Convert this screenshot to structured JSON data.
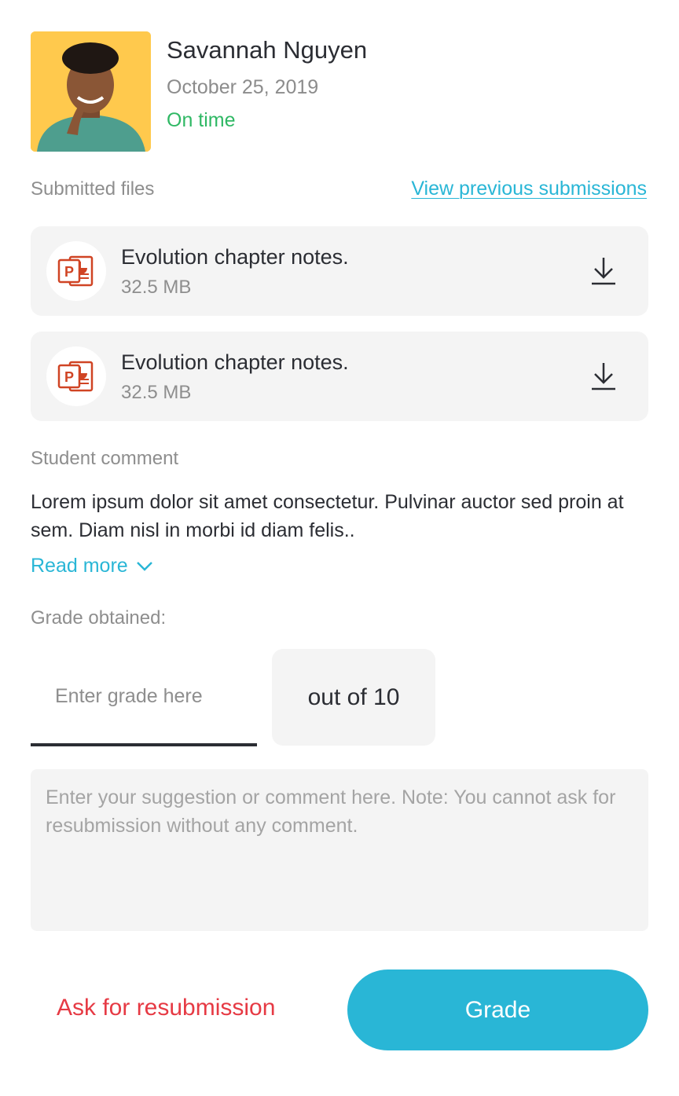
{
  "student": {
    "name": "Savannah Nguyen",
    "date": "October 25, 2019",
    "status": "On time"
  },
  "files_section": {
    "label": "Submitted files",
    "view_previous_link": "View previous submissions",
    "files": [
      {
        "name": "Evolution chapter notes.",
        "size": "32.5 MB",
        "icon": "powerpoint-icon"
      },
      {
        "name": "Evolution chapter notes.",
        "size": "32.5 MB",
        "icon": "powerpoint-icon"
      }
    ]
  },
  "comment_section": {
    "label": "Student comment",
    "text": "Lorem ipsum dolor sit amet consectetur. Pulvinar auctor sed proin at sem. Diam nisl in morbi id diam felis..",
    "read_more": "Read more"
  },
  "grade_section": {
    "label": "Grade obtained:",
    "input_placeholder": "Enter grade here",
    "out_of": "out of 10",
    "comment_placeholder": "Enter your suggestion or comment here. Note: You cannot ask for resubmission without any comment."
  },
  "actions": {
    "resubmit_label": "Ask for resubmission",
    "grade_label": "Grade"
  },
  "colors": {
    "accent": "#29b6d6",
    "status_on_time": "#2fb864",
    "danger": "#e63a44",
    "avatar_bg": "#ffc94d",
    "powerpoint": "#d04424"
  }
}
